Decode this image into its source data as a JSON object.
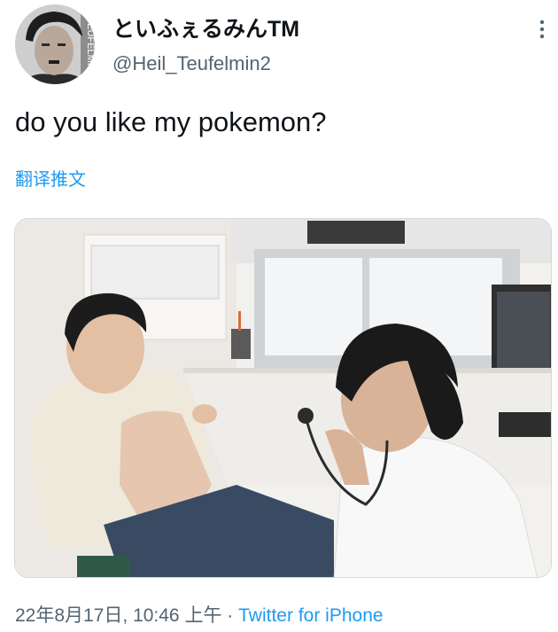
{
  "tweet": {
    "author": {
      "display_name": "といふぇるみんTM",
      "handle": "@Heil_Teufelmin2",
      "avatar_overlay_text": "EUFELMI"
    },
    "text": "do you like my pokemon?",
    "translate_label": "翻译推文",
    "timestamp": "22年8月17日, 10:46 上午",
    "separator": "·",
    "source": "Twitter for iPhone",
    "menu_icon": "more-vertical-icon"
  },
  "colors": {
    "text_primary": "#0f1419",
    "text_secondary": "#536471",
    "link": "#1d9bf0"
  }
}
